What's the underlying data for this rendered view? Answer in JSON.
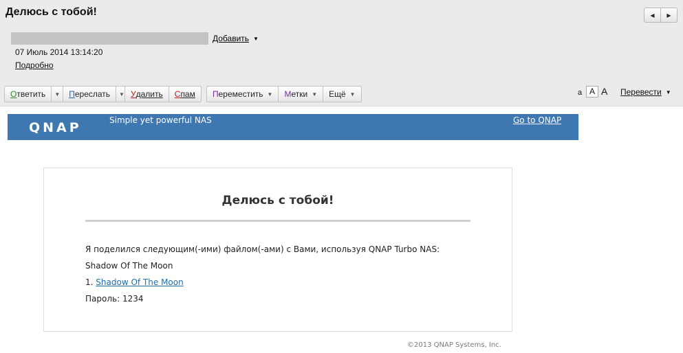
{
  "header": {
    "subject": "Делюсь с тобой!",
    "nav": {
      "prev_icon": "◀",
      "next_icon": "▶"
    },
    "add_label": "Добавить",
    "date": "07 Июль 2014 13:14:20",
    "details_label": "Подробно"
  },
  "toolbar": {
    "reply": {
      "first": "О",
      "rest": "тветить",
      "accent": "#2a8a2a"
    },
    "forward": {
      "first": "П",
      "rest": "ереслать",
      "accent": "#1d5fb3"
    },
    "delete": {
      "first": "У",
      "rest": "далить",
      "accent": "#c01a1a"
    },
    "spam": {
      "first": "С",
      "rest": "пам",
      "accent": "#c01a1a"
    },
    "move": {
      "first": "П",
      "rest": "ереместить",
      "accent": "#7a2a9a"
    },
    "tags": {
      "first": "М",
      "rest": "етки",
      "accent": "#7a2a9a"
    },
    "more": {
      "first": "Е",
      "rest": "щё",
      "accent": "#222222"
    },
    "font_small": "a",
    "font_medium": "A",
    "font_large": "A",
    "translate_label": "Перевести"
  },
  "banner": {
    "logo_text": "QNAP",
    "tagline": "Simple yet powerful NAS",
    "goto_link": "Go to QNAP",
    "color": "#3f78b0"
  },
  "message": {
    "title": "Делюсь с тобой!",
    "intro": "Я поделился следующим(-ими) файлом(-ами) с Вами, используя QNAP Turbo NAS:",
    "file_name": "Shadow Of The Moon",
    "file_index": "1.",
    "file_link": "Shadow Of The Moon",
    "password_label": "Пароль:",
    "password_value": "1234"
  },
  "footer": {
    "copyright": "©2013 QNAP Systems, Inc."
  }
}
